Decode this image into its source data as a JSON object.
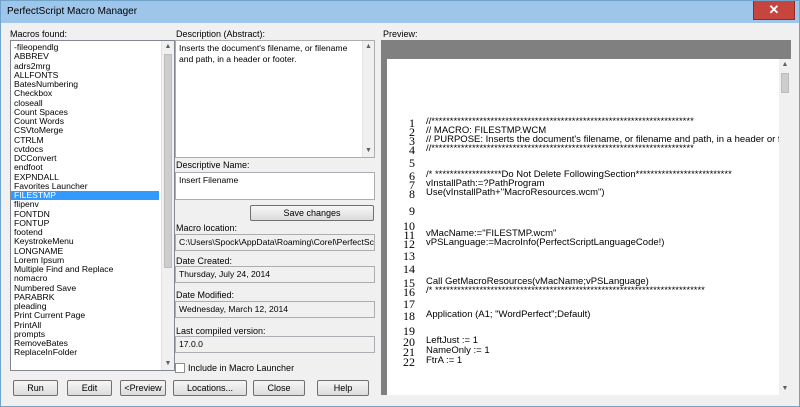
{
  "window": {
    "title": "PerfectScript Macro Manager",
    "close_glyph": "✕",
    "titlebar_color": "#9ec6ea",
    "close_color": "#c7453f",
    "selection_color": "#3399ff"
  },
  "labels": {
    "macros_found": "Macros found:",
    "description": "Description (Abstract):",
    "descriptive_name": "Descriptive Name:",
    "macro_location": "Macro location:",
    "date_created": "Date Created:",
    "date_modified": "Date Modified:",
    "last_compiled": "Last compiled version:",
    "preview": "Preview:"
  },
  "macros": [
    "-fileopendlg",
    "ABBREV",
    "adrs2mrg",
    "ALLFONTS",
    "BatesNumbering",
    "Checkbox",
    "closeall",
    "Count Spaces",
    "Count Words",
    "CSVtoMerge",
    "CTRLM",
    "cvtdocs",
    "DCConvert",
    "endfoot",
    "EXPNDALL",
    "Favorites Launcher",
    "FILESTMP",
    "flipenv",
    "FONTDN",
    "FONTUP",
    "footend",
    "KeystrokeMenu",
    "LONGNAME",
    "Lorem Ipsum",
    "Multiple Find and Replace",
    "nomacro",
    "Numbered Save",
    "PARABRK",
    "pleading",
    "Print Current Page",
    "PrintAll",
    "prompts",
    "RemoveBates",
    "ReplaceInFolder"
  ],
  "selected_macro": "FILESTMP",
  "details": {
    "description": "Inserts the document's filename, or filename and path, in a header or footer.",
    "descriptive_name": "Insert Filename",
    "location": "C:\\Users\\Spock\\AppData\\Roaming\\Corel\\PerfectScript",
    "date_created": "Thursday, July 24, 2014",
    "date_modified": "Wednesday, March 12, 2014",
    "compiled_version": "17.0.0"
  },
  "checkbox": {
    "label": "Include in Macro Launcher",
    "checked": false
  },
  "buttons": {
    "save_changes": "Save changes",
    "run": "Run",
    "edit": "Edit",
    "preview": "<Preview",
    "locations": "Locations...",
    "close": "Close",
    "help": "Help"
  },
  "preview_lines": [
    {
      "n": "1",
      "text": "//***********************************************************************"
    },
    {
      "n": "2",
      "text": "// MACRO: FILESTMP.WCM"
    },
    {
      "n": "3",
      "text": "// PURPOSE: Inserts the document's filename, or filename and path, in a header or footer."
    },
    {
      "n": "4",
      "text": "//***********************************************************************"
    },
    {
      "n": "5",
      "text": ""
    },
    {
      "n": "6",
      "text": "/* ******************Do Not Delete FollowingSection**************************"
    },
    {
      "n": "7",
      "text": "vInstallPath:=?PathProgram"
    },
    {
      "n": "8",
      "text": "Use(vInstallPath+\"MacroResources.wcm\")"
    },
    {
      "n": "9",
      "text": ""
    },
    {
      "n": "10",
      "text": ""
    },
    {
      "n": "11",
      "text": "vMacName:=\"FILESTMP.wcm\""
    },
    {
      "n": "12",
      "text": "vPSLanguage:=MacroInfo(PerfectScriptLanguageCode!)"
    },
    {
      "n": "13",
      "text": ""
    },
    {
      "n": "14",
      "text": ""
    },
    {
      "n": "15",
      "text": "Call GetMacroResources(vMacName;vPSLanguage)"
    },
    {
      "n": "16",
      "text": "/* *************************************************************************"
    },
    {
      "n": "17",
      "text": ""
    },
    {
      "n": "18",
      "text": "Application (A1; \"WordPerfect\";Default)"
    },
    {
      "n": "19",
      "text": ""
    },
    {
      "n": "20",
      "text": "LeftJust := 1"
    },
    {
      "n": "21",
      "text": "NameOnly := 1"
    },
    {
      "n": "22",
      "text": "FtrA := 1"
    }
  ]
}
